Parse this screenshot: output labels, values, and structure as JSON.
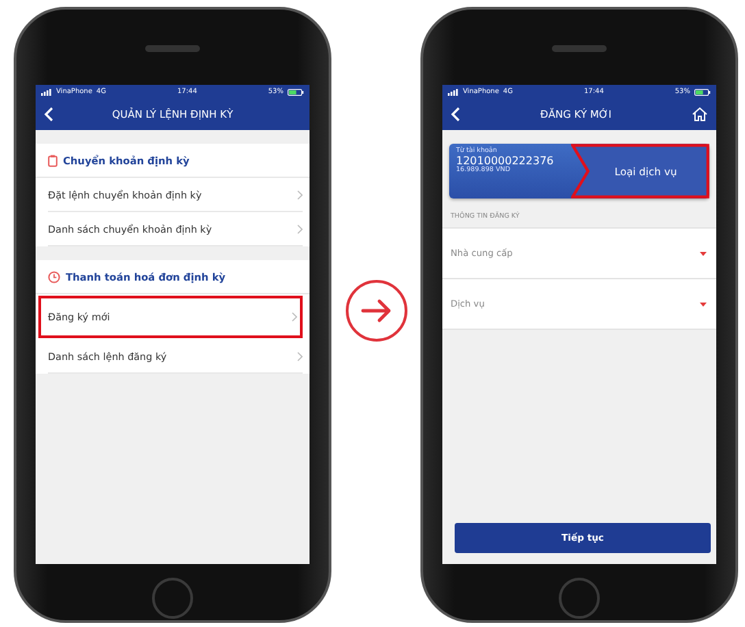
{
  "left_screen": {
    "status_bar": {
      "carrier": "VinaPhone",
      "network": "4G",
      "time": "17:44",
      "battery": "53%"
    },
    "title": "QUẢN LÝ LỆNH ĐỊNH KỲ",
    "sections": [
      {
        "kind": "transfer",
        "heading": "Chuyển khoản định kỳ",
        "items": [
          {
            "label": "Đặt lệnh chuyển khoản định kỳ",
            "highlighted": false
          },
          {
            "label": "Danh sách chuyển khoản định kỳ",
            "highlighted": false
          }
        ]
      },
      {
        "kind": "bill",
        "heading": "Thanh toán hoá đơn định kỳ",
        "items": [
          {
            "label": "Đăng ký mới",
            "highlighted": true
          },
          {
            "label": "Danh sách lệnh đăng ký",
            "highlighted": false
          }
        ]
      }
    ]
  },
  "right_screen": {
    "status_bar": {
      "carrier": "VinaPhone",
      "network": "4G",
      "time": "17:44",
      "battery": "53%"
    },
    "title": "ĐĂNG KÝ MỚI",
    "account": {
      "caption": "Từ tài khoản",
      "number": "12010000222376",
      "balance": "16.989.898 VND"
    },
    "service_step": {
      "label": "Loại dịch vụ",
      "highlighted": true
    },
    "section_heading": "THÔNG TIN ĐĂNG KÝ",
    "fields": [
      {
        "placeholder": "Nhà cung cấp"
      },
      {
        "placeholder": "Dịch vụ"
      }
    ],
    "button": "Tiếp tục"
  }
}
